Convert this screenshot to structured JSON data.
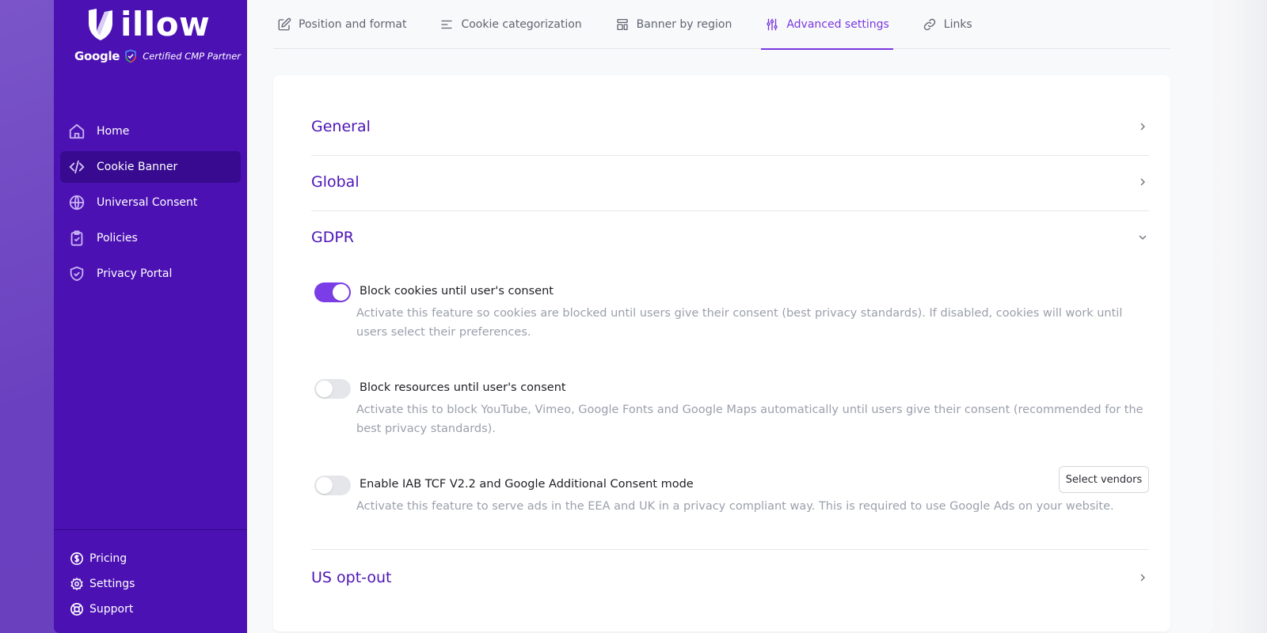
{
  "brand": {
    "name": "illow",
    "partner_google": "Google",
    "partner_text": "Certified CMP Partner"
  },
  "colors": {
    "sidebar_bg": "#4b11b3",
    "sidebar_active": "#370a8f",
    "accent": "#7a37e0",
    "section_title": "#4d14b6",
    "toggle_on": "#7b3de6"
  },
  "sidebar": {
    "items": [
      {
        "label": "Home",
        "icon": "home-icon",
        "active": false
      },
      {
        "label": "Cookie Banner",
        "icon": "code-icon",
        "active": true
      },
      {
        "label": "Universal Consent",
        "icon": "globe-icon",
        "active": false
      },
      {
        "label": "Policies",
        "icon": "clipboard-check-icon",
        "active": false
      },
      {
        "label": "Privacy Portal",
        "icon": "shield-check-icon",
        "active": false
      }
    ],
    "bottom_items": [
      {
        "label": "Pricing",
        "icon": "dollar-icon"
      },
      {
        "label": "Settings",
        "icon": "gear-icon"
      },
      {
        "label": "Support",
        "icon": "lifebuoy-icon"
      }
    ]
  },
  "tabs": [
    {
      "label": "Position and format",
      "icon": "edit-icon",
      "active": false
    },
    {
      "label": "Cookie categorization",
      "icon": "align-left-icon",
      "active": false
    },
    {
      "label": "Banner by region",
      "icon": "layout-icon",
      "active": false
    },
    {
      "label": "Advanced settings",
      "icon": "sliders-icon",
      "active": true
    },
    {
      "label": "Links",
      "icon": "link-icon",
      "active": false
    }
  ],
  "sections": [
    {
      "title": "General",
      "expanded": false
    },
    {
      "title": "Global",
      "expanded": false
    },
    {
      "title": "GDPR",
      "expanded": true
    },
    {
      "title": "US opt-out",
      "expanded": false
    }
  ],
  "gdpr_settings": [
    {
      "title": "Block cookies until user's consent",
      "description": "Activate this feature so cookies are blocked until users give their consent (best privacy standards).  If disabled, cookies will work until users select their preferences.",
      "enabled": true
    },
    {
      "title": "Block resources until user's consent",
      "description": "Activate this to block YouTube, Vimeo, Google  Fonts and Google  Maps automatically until users give their consent (recommended for the best privacy standards).",
      "enabled": false
    },
    {
      "title": "Enable  IAB TCF V2.2 and Google Additional Consent mode",
      "description": "Activate this feature to serve ads in the  EEA and UK in a privacy compliant way. This is required to use Google Ads on your website.",
      "enabled": false,
      "button_label": "Select vendors"
    }
  ]
}
